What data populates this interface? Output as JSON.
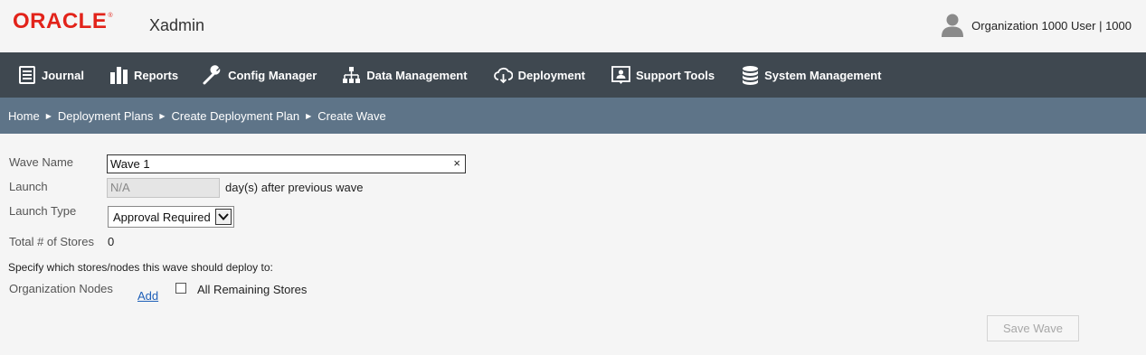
{
  "header": {
    "logo_text": "ORACLE",
    "logo_reg": "®",
    "app_name": "Xadmin",
    "user_text": "Organization 1000 User | 1000"
  },
  "nav": {
    "items": [
      {
        "label": "Journal",
        "icon": "journal-icon"
      },
      {
        "label": "Reports",
        "icon": "reports-icon"
      },
      {
        "label": "Config Manager",
        "icon": "wrench-icon"
      },
      {
        "label": "Data Management",
        "icon": "hierarchy-icon"
      },
      {
        "label": "Deployment",
        "icon": "cloud-download-icon"
      },
      {
        "label": "Support Tools",
        "icon": "support-icon"
      },
      {
        "label": "System Management",
        "icon": "database-icon"
      }
    ]
  },
  "breadcrumb": [
    "Home",
    "Deployment Plans",
    "Create Deployment Plan",
    "Create Wave"
  ],
  "breadcrumb_separator": "▶",
  "form": {
    "wave_name_label": "Wave Name",
    "wave_name_value": "Wave 1",
    "clear_symbol": "×",
    "launch_label": "Launch",
    "launch_value": "N/A",
    "launch_suffix": "day(s) after previous wave",
    "launch_type_label": "Launch Type",
    "launch_type_value": "Approval Required",
    "total_stores_label": "Total # of Stores",
    "total_stores_value": "0",
    "instructions": "Specify which stores/nodes this wave should deploy to:",
    "org_nodes_label": "Organization Nodes",
    "add_link": "Add",
    "all_remaining_label": "All Remaining Stores",
    "all_remaining_checked": false,
    "save_button": "Save Wave"
  },
  "colors": {
    "brand_red": "#e2231a",
    "nav_bg": "#3f4850",
    "breadcrumb_bg": "#5e7488",
    "link": "#1e5fb8"
  }
}
